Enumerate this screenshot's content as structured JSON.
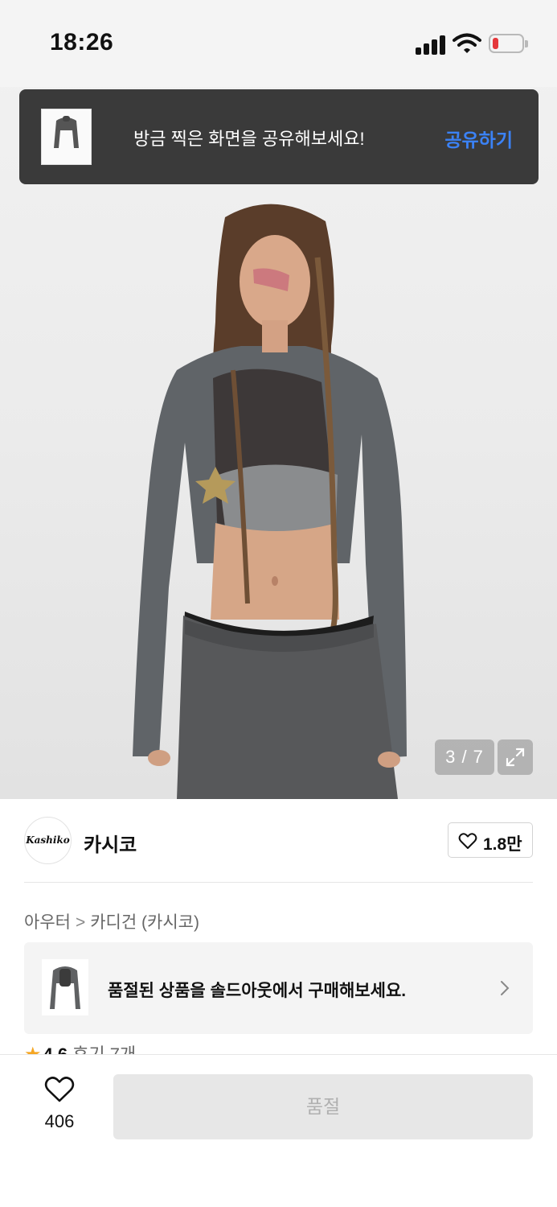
{
  "status_bar": {
    "time": "18:26"
  },
  "share_toast": {
    "message": "방금 찍은 화면을 공유해보세요!",
    "action_label": "공유하기",
    "action_color": "#3b82f6"
  },
  "gallery": {
    "counter": "3 / 7",
    "expand_icon": "expand-icon"
  },
  "brand": {
    "logo_text": "Kashiko",
    "name": "카시코",
    "likes": "1.8만",
    "heart_icon": "heart-outline-icon"
  },
  "breadcrumb": {
    "level1": "아우터",
    "separator": ">",
    "level2": "카디건 (카시코)"
  },
  "soldout_banner": {
    "text": "품절된 상품을 솔드아웃에서 구매해보세요.",
    "arrow_icon": "chevron-right-icon"
  },
  "rating": {
    "star_icon": "star-icon",
    "score": "4.6",
    "reviews": "후기 7개"
  },
  "bottom_bar": {
    "wish_count": "406",
    "purchase_label": "품절",
    "purchase_disabled": true
  }
}
